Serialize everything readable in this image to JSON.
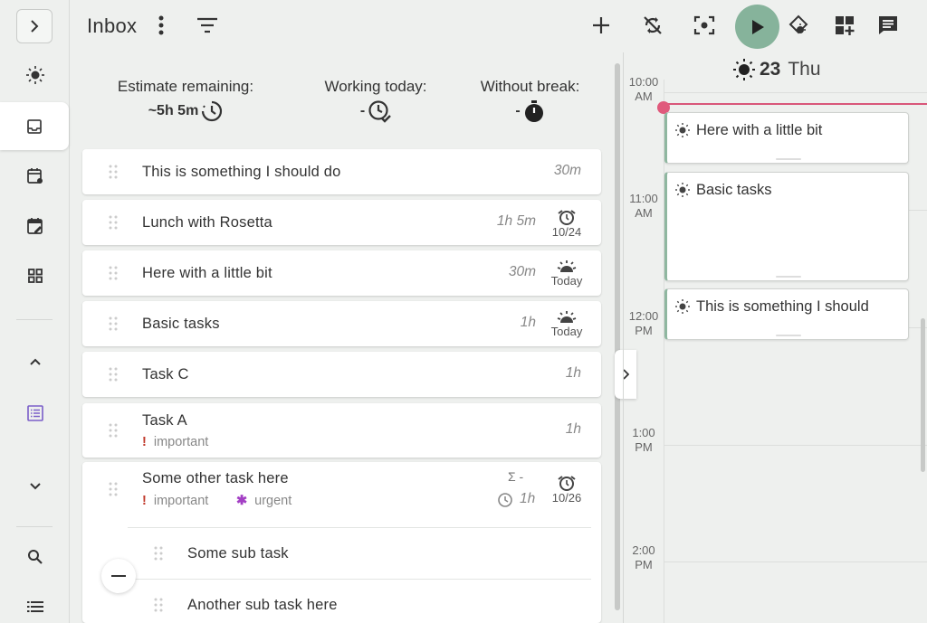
{
  "header": {
    "title": "Inbox"
  },
  "stats": [
    {
      "label": "Estimate remaining:",
      "value": "~5h 5m"
    },
    {
      "label": "Working today:",
      "value": "-"
    },
    {
      "label": "Without break:",
      "value": "-"
    }
  ],
  "tasks": [
    {
      "name": "This is something I should do",
      "estimate": "30m"
    },
    {
      "name": "Lunch with Rosetta",
      "estimate": "1h 5m",
      "due": "10/24"
    },
    {
      "name": "Here with a little bit",
      "estimate": "30m",
      "due": "Today"
    },
    {
      "name": "Basic tasks",
      "estimate": "1h",
      "due": "Today"
    },
    {
      "name": "Task C",
      "estimate": "1h"
    },
    {
      "name": "Task A",
      "estimate": "1h",
      "tag1": "important"
    },
    {
      "name": "Some other task here",
      "sum": "Σ -",
      "estimate": "1h",
      "due": "10/26",
      "tag1": "important",
      "tag2": "urgent"
    }
  ],
  "subtasks": [
    {
      "name": "Some sub task"
    },
    {
      "name": "Another sub task here"
    }
  ],
  "calendar": {
    "day": "23",
    "weekday": "Thu",
    "hours": [
      {
        "h": "10:00",
        "p": "AM"
      },
      {
        "h": "11:00",
        "p": "AM"
      },
      {
        "h": "12:00",
        "p": "PM"
      },
      {
        "h": "1:00",
        "p": "PM"
      },
      {
        "h": "2:00",
        "p": "PM"
      }
    ],
    "events": [
      {
        "title": "Here with a little bit"
      },
      {
        "title": "Basic tasks"
      },
      {
        "title": "This is something I should"
      }
    ]
  },
  "colors": {
    "accent": "#86b39b",
    "now_line": "#d9577a",
    "important": "#c0392b",
    "urgent": "#a33fc4"
  }
}
